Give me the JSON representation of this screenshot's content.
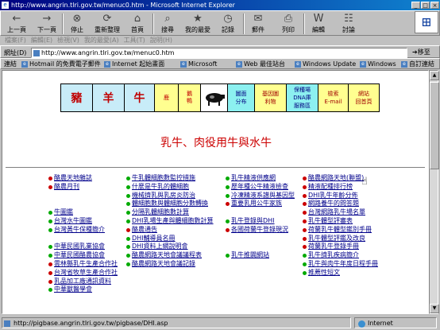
{
  "window": {
    "title": "http://www.angrin.tlri.gov.tw/menuc0.htm - Microsoft Internet Explorer",
    "min": "_",
    "max": "□",
    "close": "×"
  },
  "toolbar": [
    {
      "label": "上一頁",
      "icon": "back-icon",
      "glyph": "←"
    },
    {
      "label": "下一頁",
      "icon": "forward-icon",
      "glyph": "→"
    },
    {
      "label": "停止",
      "icon": "stop-icon",
      "glyph": "⊗"
    },
    {
      "label": "重新整理",
      "icon": "refresh-icon",
      "glyph": "⟳"
    },
    {
      "label": "首頁",
      "icon": "home-icon",
      "glyph": "⌂"
    },
    {
      "label": "搜尋",
      "icon": "search-icon",
      "glyph": "⌕"
    },
    {
      "label": "我的最愛",
      "icon": "favorites-icon",
      "glyph": "★"
    },
    {
      "label": "記錄",
      "icon": "history-icon",
      "glyph": "◷"
    },
    {
      "label": "郵件",
      "icon": "mail-icon",
      "glyph": "✉"
    },
    {
      "label": "列印",
      "icon": "print-icon",
      "glyph": "⎙"
    },
    {
      "label": "編輯",
      "icon": "edit-icon",
      "glyph": "W"
    },
    {
      "label": "討論",
      "icon": "discuss-icon",
      "glyph": "☷"
    }
  ],
  "menus": [
    "檔案(F)",
    "編輯(E)",
    "檢視(V)",
    "我的最愛(A)",
    "工具(T)",
    "說明(H)"
  ],
  "address": {
    "label": "網址(D)",
    "url": "http://www.angrin.tlri.gov.tw/menuc0.htm",
    "go": "移至"
  },
  "links": {
    "label": "連結",
    "items": [
      "Hotmail 的免費電子郵件",
      "Internet 起始畫面",
      "Microsoft",
      "Web 最佳站台",
      "Windows Update",
      "Windows",
      "自訂連結"
    ]
  },
  "banner": {
    "pig": "豬",
    "sheep": "羊",
    "cattle": "牛",
    "deer": "鹿",
    "duck_goose": "鵝鴨",
    "map": [
      "圖面",
      "分布"
    ],
    "basic": [
      "基因圖",
      "利物"
    ],
    "dna": [
      "保種場",
      "DNA庫",
      "服務區"
    ],
    "search": [
      "檢索",
      "E-mail"
    ],
    "sites": [
      "網站",
      "回首頁"
    ]
  },
  "page": {
    "heading": "乳牛、肉役用牛與水牛"
  },
  "bullet_colors": {
    "red": "#cc0000",
    "green": "#00aa00"
  },
  "columns": [
    {
      "rows": [
        {
          "t": "酪農天地雜誌",
          "c": "red"
        },
        {
          "t": "酪農月刊",
          "c": "red"
        },
        {
          "t": "",
          "c": ""
        },
        {
          "t": "",
          "c": ""
        },
        {
          "t": "牛圖鑑",
          "c": "green"
        },
        {
          "t": "台灣水牛圖鑑",
          "c": "green"
        },
        {
          "t": "台灣黃牛保種簡介",
          "c": "green"
        },
        {
          "t": "",
          "c": ""
        },
        {
          "t": "中華民國乳業協會",
          "c": "green"
        },
        {
          "t": "中華民國酪農協會",
          "c": "green"
        },
        {
          "t": "雲林縣乳牛生產合作社",
          "c": "red"
        },
        {
          "t": "台灣省牧草生產合作社",
          "c": "red"
        },
        {
          "t": "乳品加工廠通訊資料",
          "c": "red"
        },
        {
          "t": "中華獸醫學會",
          "c": "green"
        }
      ]
    },
    {
      "rows": [
        {
          "t": "牛乳體細胞數監控措施",
          "c": "green"
        },
        {
          "t": "什麼是牛乳的體細胞",
          "c": "green"
        },
        {
          "t": "機械擠乳與乳房炎防治",
          "c": "green"
        },
        {
          "t": "體細胞數與體細胞分數轉換",
          "c": "green"
        },
        {
          "t": "分隔乳體細胞數計算",
          "c": "green"
        },
        {
          "t": "DHI乳場生產與體細胞數計算",
          "c": "green"
        },
        {
          "t": "酪農通告",
          "c": "red"
        },
        {
          "t": "DHI輔導員名冊",
          "c": "green"
        },
        {
          "t": "DHI資料上網說明會",
          "c": "green"
        },
        {
          "t": "酪農網路天地會議議程表",
          "c": "green"
        },
        {
          "t": "酪農網路天地會議記錄",
          "c": "green"
        }
      ]
    },
    {
      "rows": [
        {
          "t": "乳牛精液供應網",
          "c": "green"
        },
        {
          "t": "歷年種公牛精液檢查",
          "c": "green"
        },
        {
          "t": "冷凍精液系譜與基因型",
          "c": "green"
        },
        {
          "t": "重要乳用公牛家族",
          "c": "red"
        },
        {
          "t": "",
          "c": ""
        },
        {
          "t": "乳牛登錄與DHI",
          "c": "green"
        },
        {
          "t": "各國荷蘭牛登錄現況",
          "c": "red"
        },
        {
          "t": "",
          "c": ""
        },
        {
          "t": "",
          "c": ""
        },
        {
          "t": "乳牛推闢網站",
          "c": "green"
        }
      ]
    },
    {
      "rows": [
        {
          "t": "酪農網路天地(聯盟)",
          "c": "red"
        },
        {
          "t": "精液配種排行榜",
          "c": "red"
        },
        {
          "t": "DHI乳牛年齡分佈",
          "c": "red"
        },
        {
          "t": "網路養牛的問答題",
          "c": "red"
        },
        {
          "t": "台灣網路乳牛場名單",
          "c": "red"
        },
        {
          "t": "乳牛體型評審表",
          "c": "red"
        },
        {
          "t": "荷蘭乳牛體型鑑別手冊",
          "c": "red"
        },
        {
          "t": "乳牛體型評鑑及改良",
          "c": "red"
        },
        {
          "t": "荷蘭乳牛登錄手冊",
          "c": "red"
        },
        {
          "t": "乳牛擠乳疾病簡介",
          "c": "green"
        },
        {
          "t": "乳牛與肉牛年度日程手冊",
          "c": "green"
        },
        {
          "t": "推薦性短文",
          "c": "green"
        }
      ]
    }
  ],
  "status": {
    "url": "http://pigbase.angrin.tlri.gov.tw/pigbase/DHI.asp",
    "zone": "Internet"
  }
}
